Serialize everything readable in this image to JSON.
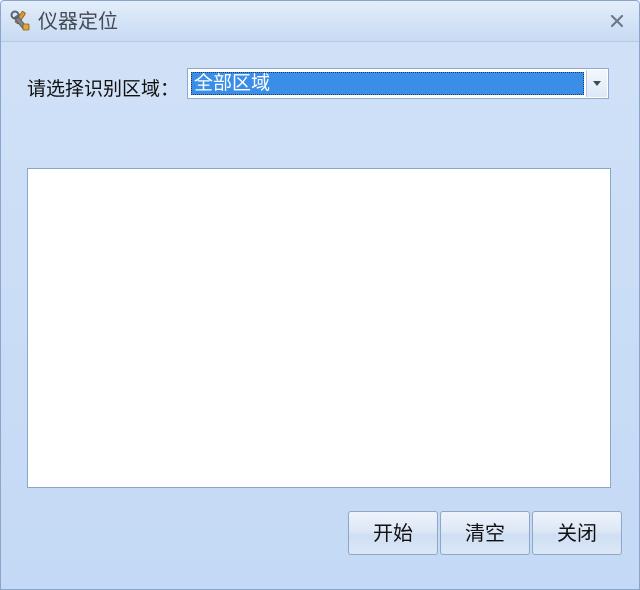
{
  "window": {
    "title": "仪器定位",
    "icon": "tools-icon",
    "close_icon": "close-icon"
  },
  "area_select": {
    "label": "请选择识别区域：",
    "selected": "全部区域",
    "arrow_icon": "chevron-down-icon"
  },
  "buttons": {
    "start": "开始",
    "clear": "清空",
    "close": "关闭"
  },
  "colors": {
    "window_bg": "#c5daf5",
    "selection": "#3a8ee8"
  }
}
